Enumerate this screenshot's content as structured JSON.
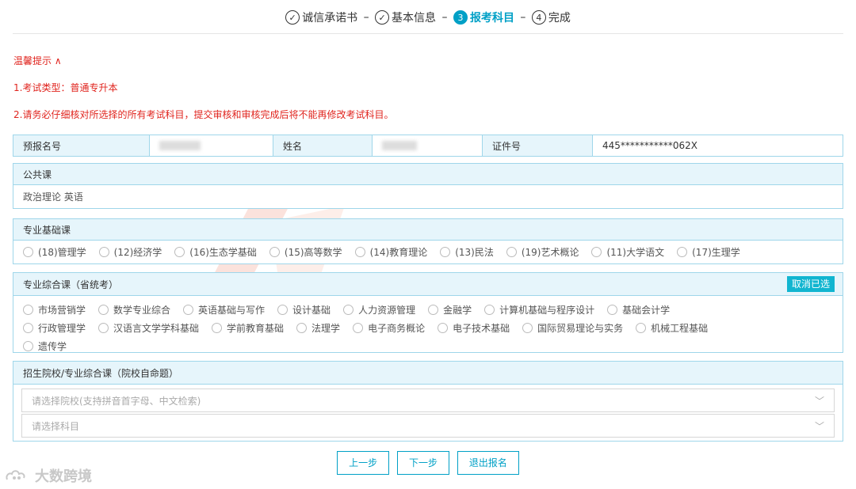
{
  "steps": [
    {
      "num": "✓",
      "label": "诚信承诺书",
      "active": false
    },
    {
      "num": "✓",
      "label": "基本信息",
      "active": false
    },
    {
      "num": "3",
      "label": "报考科目",
      "active": true
    },
    {
      "num": "4",
      "label": "完成",
      "active": false
    }
  ],
  "step_sep": "–",
  "tips": {
    "title": "温馨提示 ∧",
    "line1": "1.考试类型：普通专升本",
    "line2": "2.请务必仔细核对所选择的所有考试科目，提交审核和审核完成后将不能再修改考试科目。"
  },
  "info": {
    "reg_label": "预报名号",
    "reg_value": "",
    "name_label": "姓名",
    "name_value": "",
    "id_label": "证件号",
    "id_value": "445***********062X"
  },
  "public_course": {
    "title": "公共课",
    "value": "政治理论   英语"
  },
  "basic_course": {
    "title": "专业基础课",
    "options": [
      "(18)管理学",
      "(12)经济学",
      "(16)生态学基础",
      "(15)高等数学",
      "(14)教育理论",
      "(13)民法",
      "(19)艺术概论",
      "(11)大学语文",
      "(17)生理学"
    ]
  },
  "comprehensive": {
    "title": "专业综合课（省统考）",
    "cancel_label": "取消已选",
    "options": [
      "市场营销学",
      "数学专业综合",
      "英语基础与写作",
      "设计基础",
      "人力资源管理",
      "金融学",
      "计算机基础与程序设计",
      "基础会计学",
      "行政管理学",
      "汉语言文学学科基础",
      "学前教育基础",
      "法理学",
      "电子商务概论",
      "电子技术基础",
      "国际贸易理论与实务",
      "机械工程基础",
      "遗传学"
    ]
  },
  "school": {
    "title": "招生院校/专业综合课（院校自命题）",
    "school_placeholder": "请选择院校(支持拼音首字母、中文检索)",
    "subject_placeholder": "请选择科目"
  },
  "buttons": {
    "prev": "上一步",
    "next": "下一步",
    "exit": "退出报名"
  },
  "watermark": {
    "cn": "学辰专插本",
    "en": "XUECHEN ZHUANCHABEN"
  },
  "corner_logo": "大数跨境"
}
